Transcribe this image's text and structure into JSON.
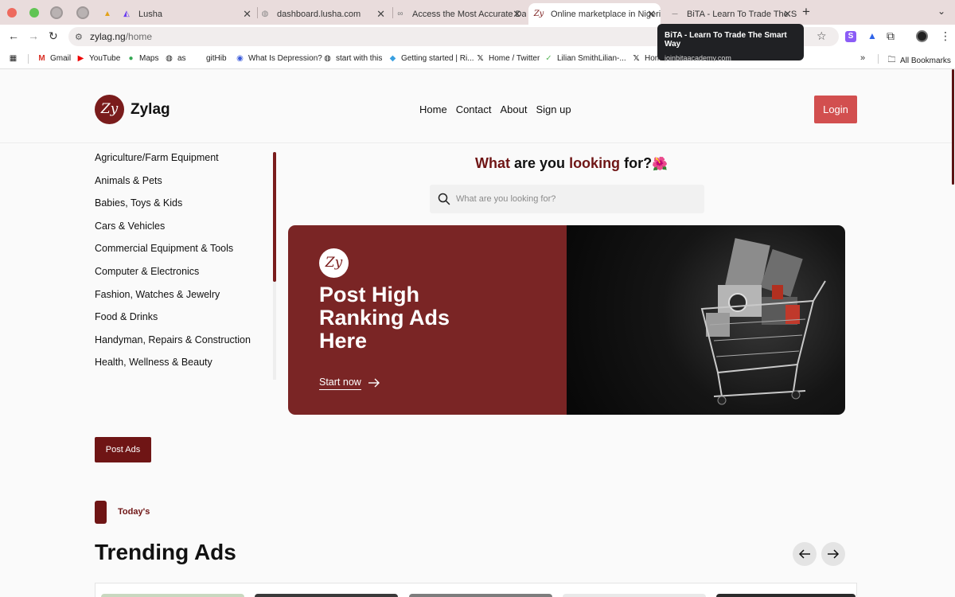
{
  "browser": {
    "tabs": [
      {
        "title": "Lusha",
        "icon": "lusha-icon"
      },
      {
        "title": "dashboard.lusha.com",
        "icon": "globe-icon"
      },
      {
        "title": "Access the Most Accurate Da",
        "icon": "link-icon"
      },
      {
        "title": "Online marketplace in Nigeria",
        "icon": "zylag-icon",
        "active": true
      },
      {
        "title": "BiTA - Learn To Trade The Sm",
        "icon": "bita-icon"
      }
    ],
    "url_host": "zylag.ng",
    "url_path": "/home",
    "bookmarks": [
      "Gmail",
      "YouTube",
      "Maps",
      "as",
      "gitHib",
      "What Is Depression?",
      "start with this",
      "Getting started | Ri...",
      "Home / Twitter",
      "Lilian SmithLilian-...",
      "Home / Twitter"
    ],
    "all_bookmarks": "All Bookmarks",
    "extension_s": "S",
    "tooltip": {
      "title": "BiTA - Learn To Trade The Smart Way",
      "url": "joinbitaacademy.com"
    }
  },
  "site": {
    "logo_mark": "Zy",
    "brand": "Zylag",
    "nav": [
      "Home",
      "Contact",
      "About",
      "Sign up"
    ],
    "login": "Login"
  },
  "categories": [
    "Agriculture/Farm Equipment",
    "Animals & Pets",
    "Babies, Toys & Kids",
    "Cars & Vehicles",
    "Commercial Equipment & Tools",
    "Computer & Electronics",
    "Fashion, Watches & Jewelry",
    "Food & Drinks",
    "Handyman, Repairs & Construction",
    "Health, Wellness & Beauty"
  ],
  "headline": {
    "w1": "What",
    "w2": "are you",
    "w3": "looking",
    "w4": "for?",
    "emoji": "🌺"
  },
  "search": {
    "placeholder": "What are you looking for?"
  },
  "hero": {
    "logo_mark": "Zy",
    "title": "Post High Ranking Ads Here",
    "cta": "Start now"
  },
  "post_ads": "Post Ads",
  "section": {
    "eyebrow": "Today's",
    "title": "Trending Ads"
  },
  "colors": {
    "brand": "#6f1515",
    "hero_bg": "#7a2525",
    "login": "#d24f4f"
  }
}
